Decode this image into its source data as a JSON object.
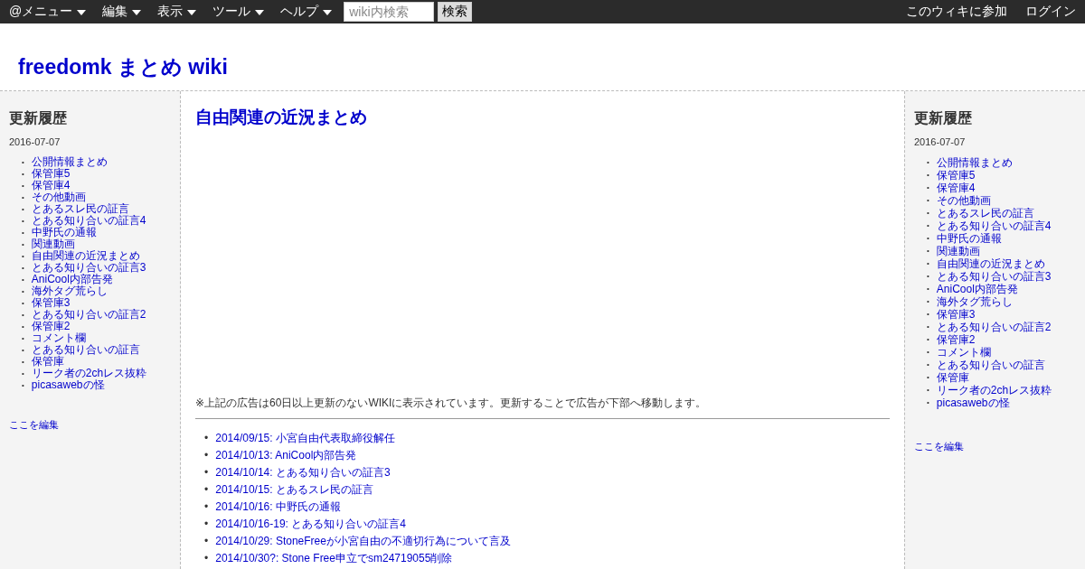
{
  "topbar": {
    "menus": [
      "@メニュー",
      "編集",
      "表示",
      "ツール",
      "ヘルプ"
    ],
    "search": {
      "placeholder": "wiki内検索",
      "button": "検索"
    },
    "right_links": [
      "このウィキに参加",
      "ログイン"
    ]
  },
  "site_title": "freedomk まとめ wiki",
  "left_sidebar": {
    "heading": "更新履歴",
    "date": "2016-07-07",
    "bullet": "•",
    "items": [
      "公開情報まとめ",
      "保管庫5",
      "保管庫4",
      "その他動画",
      "とあるスレ民の証言",
      "とある知り合いの証言4",
      "中野氏の通報",
      "関連動画",
      "自由関連の近況まとめ",
      "とある知り合いの証言3",
      "AniCool内部告発",
      "海外タグ荒らし",
      "保管庫3",
      "とある知り合いの証言2",
      "保管庫2",
      "コメント欄",
      "とある知り合いの証言",
      "保管庫",
      "リーク者の2chレス抜粋",
      "picasawebの怪"
    ],
    "edit_link": "ここを編集"
  },
  "main": {
    "title": "自由関連の近況まとめ",
    "ad_note": "※上記の広告は60日以上更新のないWIKIに表示されています。更新することで広告が下部へ移動します。",
    "bullet": "•",
    "items": [
      "2014/09/15: 小宮自由代表取締役解任",
      "2014/10/13: AniCool内部告発",
      "2014/10/14: とある知り合いの証言3",
      "2014/10/15: とあるスレ民の証言",
      "2014/10/16: 中野氏の通報",
      "2014/10/16-19: とある知り合いの証言4",
      "2014/10/29: StoneFreeが小宮自由の不適切行為について言及",
      "2014/10/30?: Stone Free申立でsm24719055削除"
    ]
  },
  "right_sidebar": {
    "heading": "更新履歴",
    "date": "2016-07-07",
    "bullet": "•",
    "items": [
      "公開情報まとめ",
      "保管庫5",
      "保管庫4",
      "その他動画",
      "とあるスレ民の証言",
      "とある知り合いの証言4",
      "中野氏の通報",
      "関連動画",
      "自由関連の近況まとめ",
      "とある知り合いの証言3",
      "AniCool内部告発",
      "海外タグ荒らし",
      "保管庫3",
      "とある知り合いの証言2",
      "保管庫2",
      "コメント欄",
      "とある知り合いの証言",
      "保管庫",
      "リーク者の2chレス抜粋",
      "picasawebの怪"
    ],
    "edit_link": "ここを編集"
  }
}
